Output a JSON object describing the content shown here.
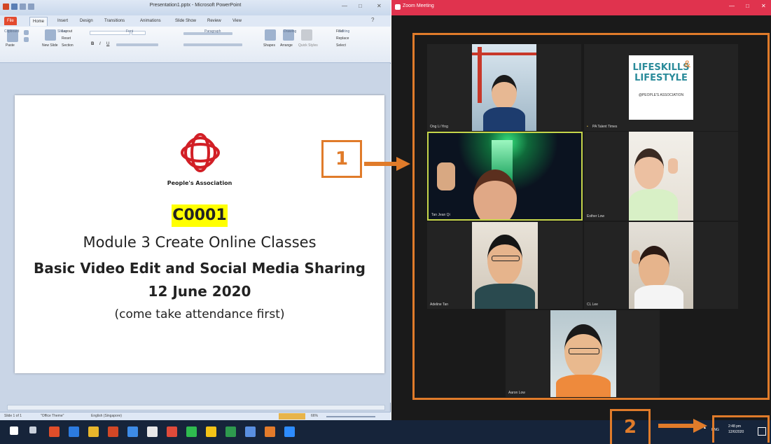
{
  "powerpoint": {
    "title": "Presentation1.pptx - Microsoft PowerPoint",
    "tabs": [
      "File",
      "Home",
      "Insert",
      "Design",
      "Transitions",
      "Animations",
      "Slide Show",
      "Review",
      "View"
    ],
    "ribbon_groups": [
      "Clipboard",
      "Slides",
      "Font",
      "Paragraph",
      "Drawing",
      "Editing"
    ],
    "ribbon_buttons": {
      "paste": "Paste",
      "new_slide": "New Slide",
      "layout": "Layout",
      "reset": "Reset",
      "section": "Section",
      "shapes": "Shapes",
      "arrange": "Arrange",
      "quick_styles": "Quick Styles",
      "find": "Find",
      "replace": "Replace",
      "select": "Select"
    },
    "slide": {
      "org_name": "People's Association",
      "code": "C0001",
      "module": "Module 3 Create Online Classes",
      "headline": "Basic Video Edit and Social Media Sharing",
      "date": "12 June 2020",
      "note": "(come take attendance first)"
    },
    "status": {
      "slide_info": "Slide 1 of 1",
      "theme": "\"Office Theme\"",
      "language": "English (Singapore)",
      "zoom": "66%"
    }
  },
  "zoom": {
    "title": "Zoom Meeting",
    "participants": [
      {
        "name": "Ong Li Ying"
      },
      {
        "name": "PA Talent Times"
      },
      {
        "name": "Tan Jean Qi"
      },
      {
        "name": "Esther Low"
      },
      {
        "name": "Adeline Tan"
      },
      {
        "name": "CL Lee"
      },
      {
        "name": "Aaron Low"
      }
    ],
    "logo_text": {
      "line1": "LIFESKILLS",
      "line2": "LIFESTYLE",
      "amp": "&",
      "sub": "@PEOPLE'S ASSOCIATION"
    }
  },
  "annotations": {
    "label1": "1",
    "label2": "2"
  },
  "taskbar": {
    "lang": "ENG",
    "time": "2:48 pm",
    "date": "12/6/2020"
  },
  "colors": {
    "annotation": "#e07b2a",
    "zoom_titlebar": "#e0334e",
    "code_highlight": "#ffff00",
    "active_speaker": "#c6d64a"
  }
}
